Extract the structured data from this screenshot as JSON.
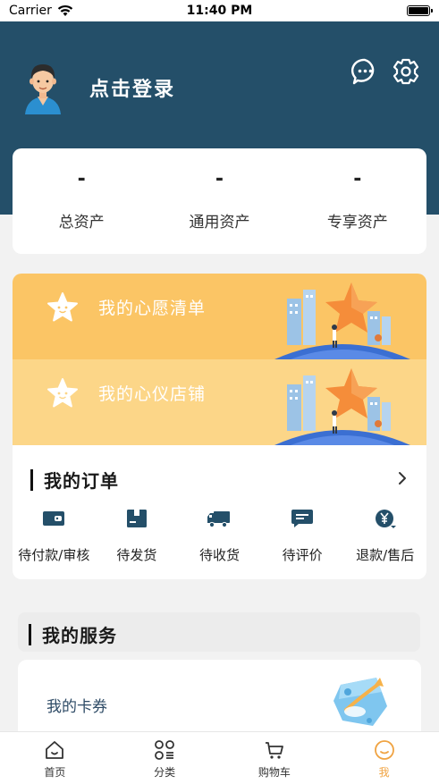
{
  "status_bar": {
    "carrier": "Carrier",
    "time": "11:40 PM"
  },
  "header": {
    "login_text": "点击登录"
  },
  "assets": [
    {
      "value": "-",
      "label": "总资产"
    },
    {
      "value": "-",
      "label": "通用资产"
    },
    {
      "value": "-",
      "label": "专享资产"
    }
  ],
  "banners": {
    "wishlist": "我的心愿清单",
    "shop": "我的心仪店铺"
  },
  "orders": {
    "title": "我的订单",
    "items": [
      {
        "label": "待付款/审核",
        "icon": "wallet-icon"
      },
      {
        "label": "待发货",
        "icon": "package-icon"
      },
      {
        "label": "待收货",
        "icon": "truck-icon"
      },
      {
        "label": "待评价",
        "icon": "comment-icon"
      },
      {
        "label": "退款/售后",
        "icon": "refund-icon"
      }
    ]
  },
  "services": {
    "title": "我的服务",
    "coupons": "我的卡券"
  },
  "tabbar": {
    "items": [
      {
        "label": "首页",
        "icon": "home-icon"
      },
      {
        "label": "分类",
        "icon": "category-icon"
      },
      {
        "label": "购物车",
        "icon": "cart-icon"
      },
      {
        "label": "我",
        "icon": "profile-icon"
      }
    ],
    "active_index": 3
  },
  "colors": {
    "header": "#244f69",
    "banner_primary": "#fbc565",
    "banner_secondary": "#fcd688",
    "tab_active": "#f0a342"
  }
}
